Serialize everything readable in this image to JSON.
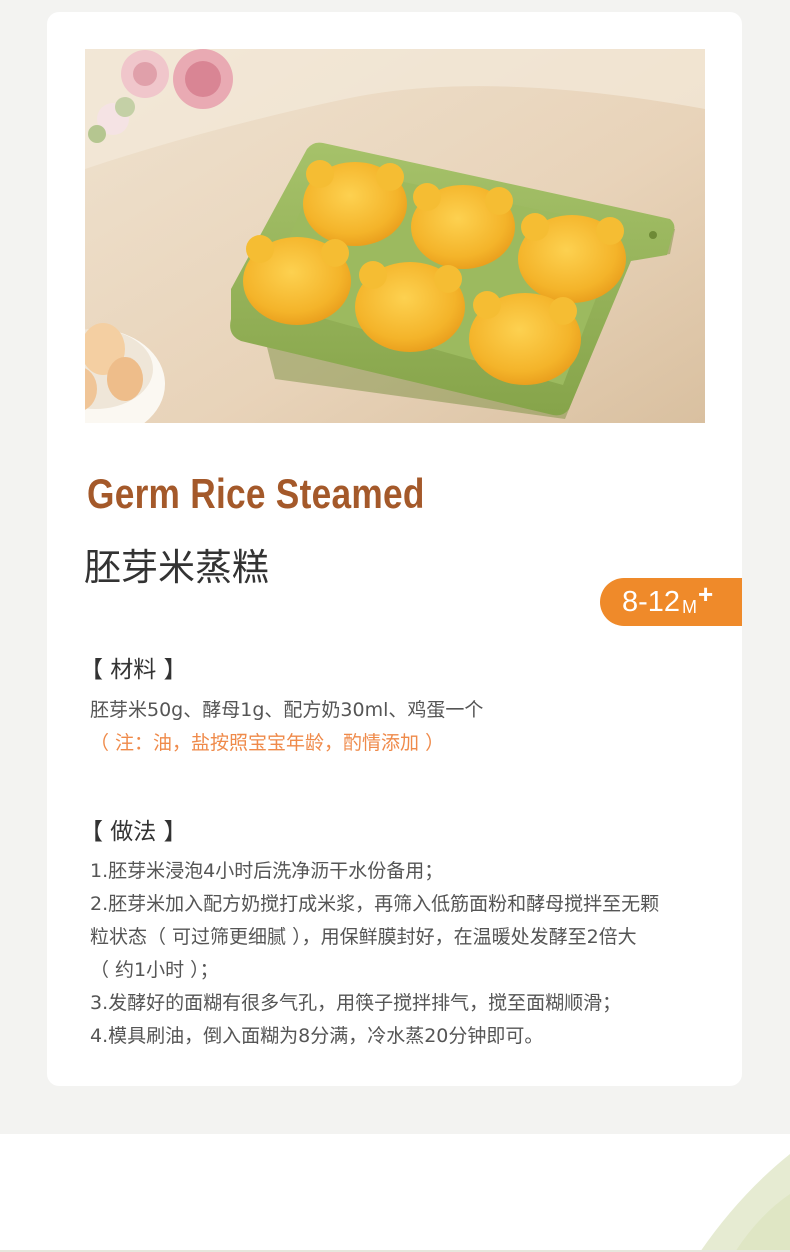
{
  "recipe": {
    "title_en": "Germ Rice Steamed",
    "title_cn": "胚芽米蒸糕",
    "age": {
      "range": "8-12",
      "unit": "M",
      "plus": "+"
    }
  },
  "ingredients": {
    "heading": "【 材料 】",
    "list": "胚芽米50g、酵母1g、配方奶30ml、鸡蛋一个",
    "note": "（ 注：油，盐按照宝宝年龄，酌情添加 ）"
  },
  "method": {
    "heading": "【 做法 】",
    "lines": [
      "1.胚芽米浸泡4小时后洗净沥干水份备用；",
      "2.胚芽米加入配方奶搅打成米浆，再筛入低筋面粉和酵母搅拌至无颗",
      "粒状态（ 可过筛更细腻 ），用保鲜膜封好，在温暖处发酵至2倍大",
      "（ 约1小时 ）；",
      "3.发酵好的面糊有很多气孔，用筷子搅拌排气，搅至面糊顺滑；",
      "4.模具刷油，倒入面糊为8分满，冷水蒸20分钟即可。"
    ]
  },
  "colors": {
    "title_en": "#a4592a",
    "badge": "#ef8a2a",
    "note": "#ef8a4a",
    "mold": "#96b35a",
    "cake": "#f2b62c"
  }
}
